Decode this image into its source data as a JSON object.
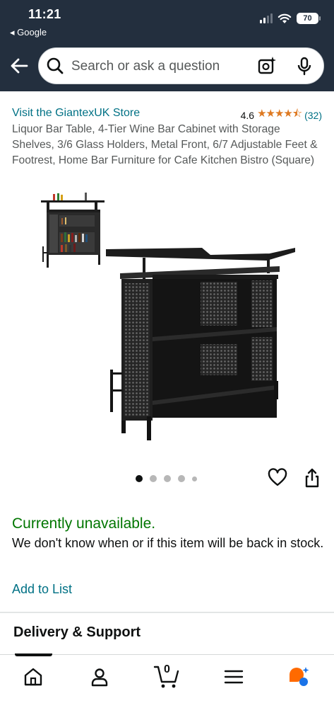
{
  "status": {
    "time": "11:21",
    "back_app": "◂ Google",
    "battery": "70"
  },
  "search": {
    "placeholder": "Search or ask a question"
  },
  "product": {
    "store_link": "Visit the GiantexUK Store",
    "rating_value": "4.6",
    "stars": "★★★★⯪",
    "rating_count": "(32)",
    "title": "Liquor Bar Table, 4-Tier Wine Bar Cabinet with Storage Shelves, 3/6 Glass Holders, Metal Front, 6/7 Adjustable Feet & Footrest, Home Bar Furniture for Cafe Kitchen Bistro (Square)"
  },
  "gallery": {
    "total_dots": 5,
    "active_index": 0
  },
  "availability": {
    "status": "Currently unavailable.",
    "message": "We don't know when or if this item will be back in stock.",
    "add_to_list": "Add to List"
  },
  "section": {
    "delivery_heading": "Delivery & Support"
  },
  "bottom_nav": {
    "cart_count": "0",
    "active": "home"
  },
  "colors": {
    "header_bg": "#232f3e",
    "link": "#007185",
    "unavailable": "#007600",
    "star": "#de7921"
  }
}
